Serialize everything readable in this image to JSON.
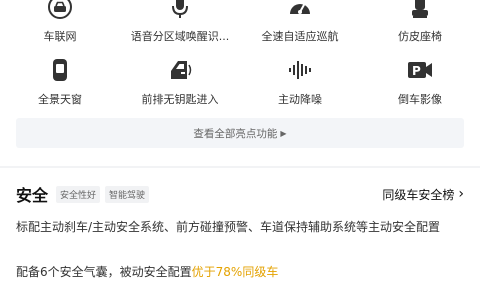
{
  "features": {
    "row1": [
      {
        "icon": "car-network-icon",
        "label": "车联网"
      },
      {
        "icon": "microphone-icon",
        "label": "语音分区域唤醒识..."
      },
      {
        "icon": "speedometer-icon",
        "label": "全速自适应巡航"
      },
      {
        "icon": "seat-icon",
        "label": "仿皮座椅"
      }
    ],
    "row2": [
      {
        "icon": "sunroof-icon",
        "label": "全景天窗"
      },
      {
        "icon": "car-door-icon",
        "label": "前排无钥匙进入"
      },
      {
        "icon": "sound-wave-icon",
        "label": "主动降噪"
      },
      {
        "icon": "parking-camera-icon",
        "label": "倒车影像"
      }
    ],
    "view_all": "查看全部亮点功能"
  },
  "safety": {
    "title": "安全",
    "tags": [
      "安全性好",
      "智能驾驶"
    ],
    "rank_link": "同级车安全榜",
    "description": "标配主动刹车/主动安全系统、前方碰撞预警、车道保持辅助系统等主动安全配置",
    "airbag_prefix": "配备6个安全气囊，被动安全配置",
    "airbag_highlight": "优于78%同级车"
  },
  "colors": {
    "highlight": "#e4a200",
    "icon": "#333333"
  }
}
